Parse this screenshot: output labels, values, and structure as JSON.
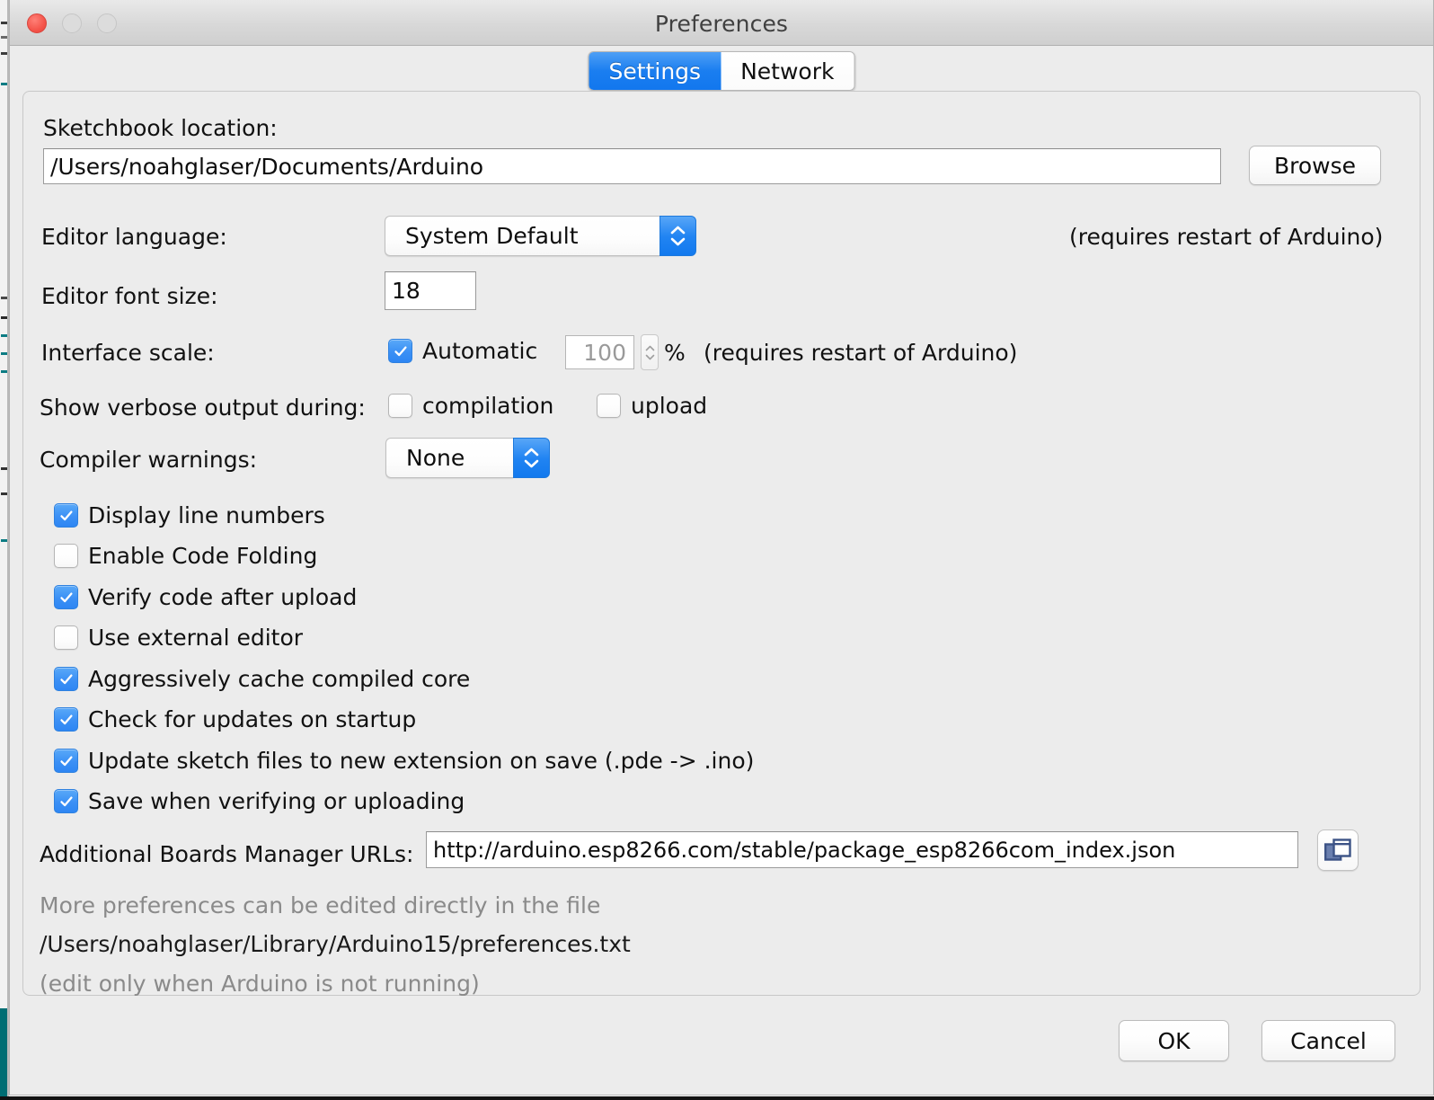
{
  "window": {
    "title": "Preferences",
    "traffic_lights": [
      "close",
      "minimize",
      "maximize"
    ]
  },
  "tabs": [
    {
      "label": "Settings",
      "active": true
    },
    {
      "label": "Network",
      "active": false
    }
  ],
  "settings": {
    "sketchbook": {
      "label": "Sketchbook location:",
      "value": "/Users/noahglaser/Documents/Arduino",
      "browse_label": "Browse"
    },
    "editor_language": {
      "label": "Editor language:",
      "value": "System Default",
      "note": "(requires restart of Arduino)"
    },
    "editor_font_size": {
      "label": "Editor font size:",
      "value": "18"
    },
    "interface_scale": {
      "label": "Interface scale:",
      "automatic_label": "Automatic",
      "automatic_checked": true,
      "scale_value": "100",
      "percent_symbol": "%",
      "note": "(requires restart of Arduino)"
    },
    "verbose": {
      "label": "Show verbose output during:",
      "compilation_label": "compilation",
      "compilation_checked": false,
      "upload_label": "upload",
      "upload_checked": false
    },
    "compiler_warnings": {
      "label": "Compiler warnings:",
      "value": "None"
    },
    "checkboxes": [
      {
        "label": "Display line numbers",
        "checked": true
      },
      {
        "label": "Enable Code Folding",
        "checked": false
      },
      {
        "label": "Verify code after upload",
        "checked": true
      },
      {
        "label": "Use external editor",
        "checked": false
      },
      {
        "label": "Aggressively cache compiled core",
        "checked": true
      },
      {
        "label": "Check for updates on startup",
        "checked": true
      },
      {
        "label": "Update sketch files to new extension on save (.pde -> .ino)",
        "checked": true
      },
      {
        "label": "Save when verifying or uploading",
        "checked": true
      }
    ],
    "boards_urls": {
      "label": "Additional Boards Manager URLs:",
      "value": "http://arduino.esp8266.com/stable/package_esp8266com_index.json",
      "icon": "windows-stack-icon"
    },
    "footer": {
      "line1": "More preferences can be edited directly in the file",
      "line2": "/Users/noahglaser/Library/Arduino15/preferences.txt",
      "line3": "(edit only when Arduino is not running)"
    }
  },
  "buttons": {
    "ok": "OK",
    "cancel": "Cancel"
  },
  "colors": {
    "accent_blue": "#1a7ef0",
    "checkbox_blue": "#3b90f5",
    "close_red": "#f45349",
    "window_bg": "#ececec",
    "icon_navy": "#3c5386"
  }
}
